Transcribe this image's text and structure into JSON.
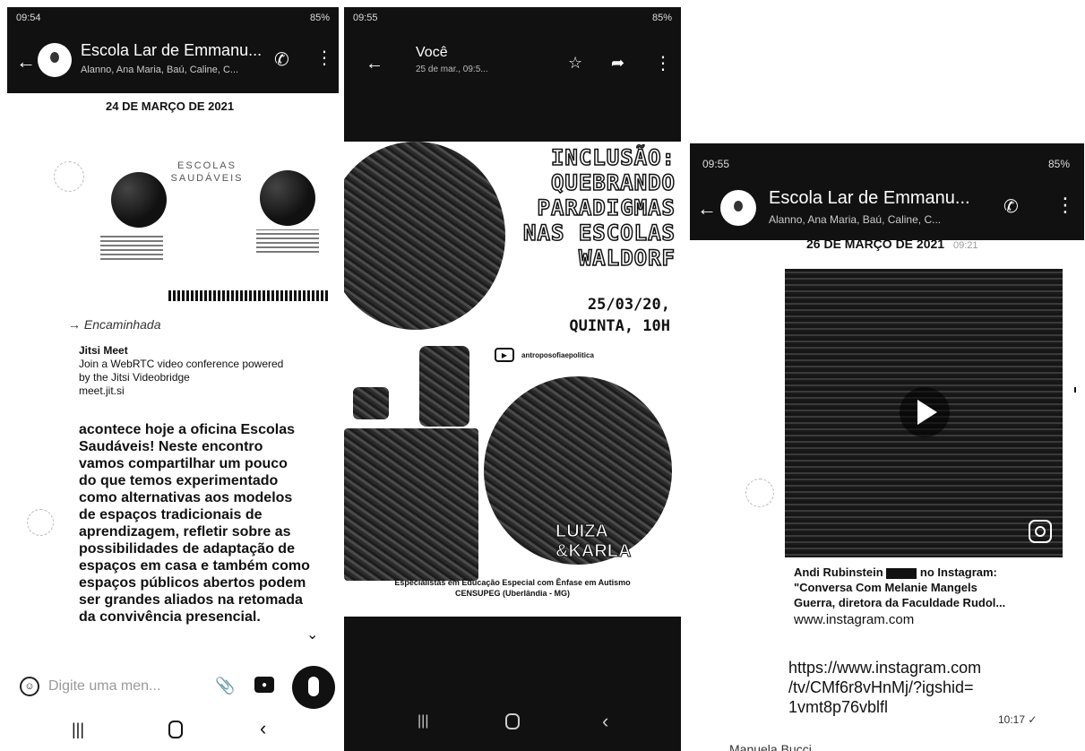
{
  "left": {
    "status_time": "09:54",
    "status_battery": "85%",
    "chat_title": "Escola Lar de Emmanu...",
    "chat_members": "Alanno, Ana Maria, Baú, Caline, C...",
    "date_header": "24 DE MARÇO DE 2021",
    "poster_title": "ESCOLAS SAUDÁVEIS",
    "forwarded_label": "Encaminhada",
    "link_title": "Jitsi Meet",
    "link_desc_1": "Join a WebRTC video conference powered",
    "link_desc_2": "by the Jitsi Videobridge",
    "link_url": "meet.jit.si",
    "message_lines": [
      "acontece hoje a oficina Escolas",
      "Saudáveis! Neste encontro",
      "vamos compartilhar um pouco",
      "do que temos experimentado",
      "como alternativas aos modelos",
      "de espaços tradicionais de",
      "aprendizagem, refletir sobre as",
      "possibilidades de adaptação de",
      "espaços em casa e também como",
      "espaços públicos abertos podem",
      "ser grandes aliados na retomada",
      "da convivência presencial."
    ],
    "input_placeholder": "Digite uma men..."
  },
  "middle": {
    "status_time": "09:55",
    "status_battery": "85%",
    "sender": "Você",
    "sent_time": "25 de mar., 09:5...",
    "poster_title_lines": [
      "INCLUSÃO:",
      "QUEBRANDO",
      "PARADIGMAS",
      "NAS ESCOLAS",
      "WALDORF"
    ],
    "poster_date": "25/03/20,",
    "poster_day_time": "QUINTA, 10H",
    "poster_handle": "antroposofiaepolitica",
    "poster_names": "LUIZA\n&KARLA",
    "poster_footer_1": "Especialistas em Educação Especial com Ênfase em Autismo",
    "poster_footer_2": "CENSUPEG (Uberlândia - MG)"
  },
  "right": {
    "status_time": "09:55",
    "status_battery": "85%",
    "chat_title": "Escola Lar de Emmanu...",
    "chat_members": "Alanno, Ana Maria, Baú, Caline, C...",
    "date_header": "26 DE MARÇO DE 2021",
    "date_time": "09:21",
    "link_title_1": "Andi Rubinstein",
    "link_title_2": "no Instagram:",
    "link_title_3": "\"Conversa Com Melanie Mangels",
    "link_title_4": "Guerra, diretora da Faculdade Rudol...",
    "link_domain": "www.instagram.com",
    "url_lines": [
      "https://www.instagram.com",
      "/tv/CMf6r8vHnMj/?igshid=",
      "1vmt8p76vblfl"
    ],
    "msg_time": "10:17 ✓",
    "cut_text": "Manuela Bucci"
  }
}
